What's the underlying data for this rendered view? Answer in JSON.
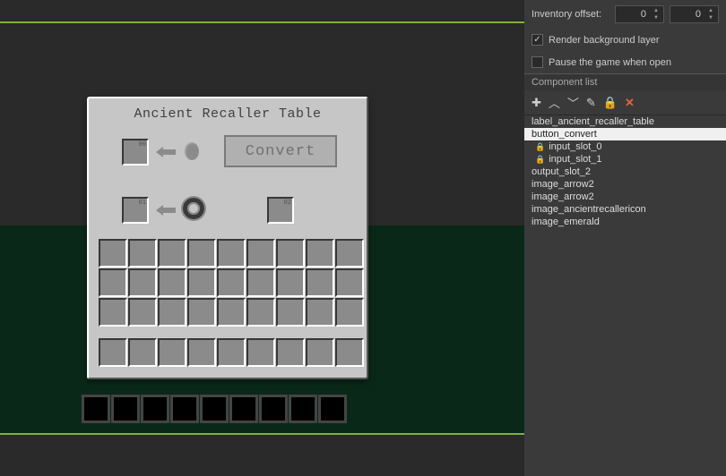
{
  "sidebar": {
    "inventory_offset_label": "Inventory offset:",
    "offset_x": "0",
    "offset_y": "0",
    "render_bg_label": "Render background layer",
    "render_bg_checked": true,
    "pause_label": "Pause the game when open",
    "pause_checked": false,
    "component_list_label": "Component list",
    "items": [
      {
        "label": "label_ancient_recaller_table",
        "locked": false,
        "selected": false
      },
      {
        "label": "button_convert",
        "locked": false,
        "selected": true
      },
      {
        "label": "input_slot_0",
        "locked": true,
        "selected": false
      },
      {
        "label": "input_slot_1",
        "locked": true,
        "selected": false
      },
      {
        "label": "output_slot_2",
        "locked": false,
        "selected": false
      },
      {
        "label": "image_arrow2",
        "locked": false,
        "selected": false
      },
      {
        "label": "image_arrow2",
        "locked": false,
        "selected": false
      },
      {
        "label": "image_ancientrecallericon",
        "locked": false,
        "selected": false
      },
      {
        "label": "image_emerald",
        "locked": false,
        "selected": false
      }
    ]
  },
  "gui": {
    "title": "Ancient Recaller Table",
    "slot0_label": "00",
    "slot1_label": "01",
    "slot2_label": "02",
    "convert_label": "Convert"
  }
}
